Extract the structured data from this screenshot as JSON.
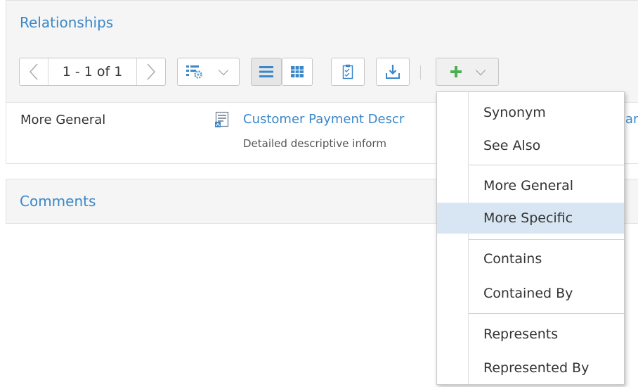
{
  "relationships": {
    "title": "Relationships",
    "toolbar": {
      "pager_text": "1 - 1 of 1",
      "colors": {
        "green_add": "#4caf50",
        "blue_icon": "#3a87c9"
      }
    },
    "row": {
      "type": "More General",
      "link": "Customer Payment Descr",
      "link_overflow": "ar",
      "description": "Detailed descriptive inform"
    }
  },
  "comments": {
    "title": "Comments"
  },
  "menu": {
    "items": [
      {
        "label": "Synonym"
      },
      {
        "label": "See Also"
      },
      {
        "label": "More General"
      },
      {
        "label": "More Specific",
        "highlighted": true
      },
      {
        "label": "Contains"
      },
      {
        "label": "Contained By"
      },
      {
        "label": "Represents"
      },
      {
        "label": "Represented By"
      }
    ]
  },
  "colors": {
    "accent": "#3a87c9",
    "highlight": "#d8e6f3",
    "header_bg": "#f5f5f5"
  }
}
